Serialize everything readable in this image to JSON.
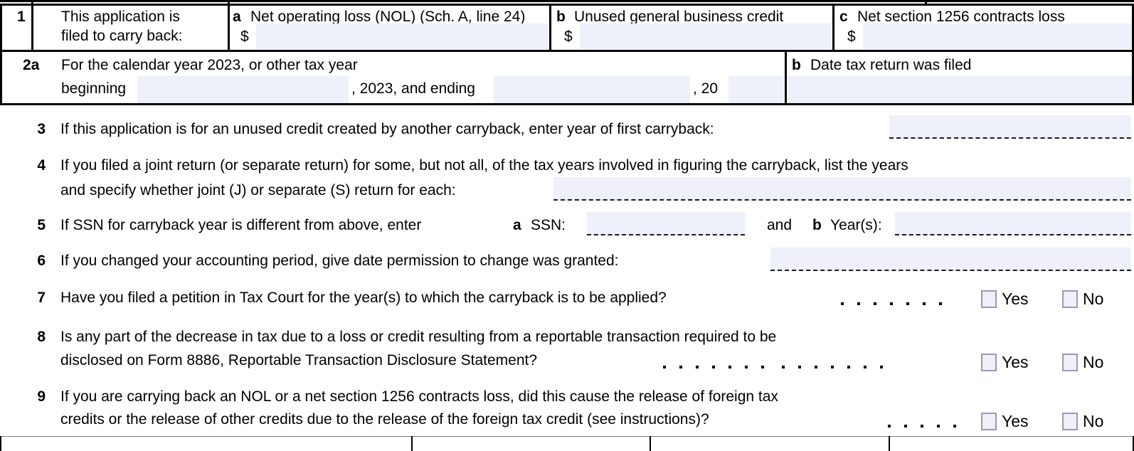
{
  "form": {
    "title": "Form 1045 Application for Tentative Refund",
    "field_fill_color": "#eef0fa",
    "checkbox_border_color": "#9a9aac",
    "rule_color": "#000000"
  },
  "line1": {
    "number": "1",
    "prompt_line_a": "This application is",
    "prompt_line_b": "filed to carry back:",
    "options": [
      {
        "letter": "a",
        "label": "Net operating loss (NOL) (Sch. A, line 24)",
        "currency_symbol": "$",
        "value": ""
      },
      {
        "letter": "b",
        "label": "Unused general business credit",
        "currency_symbol": "$",
        "value": ""
      },
      {
        "letter": "c",
        "label": "Net section 1256 contracts loss",
        "currency_symbol": "$",
        "value": ""
      }
    ]
  },
  "line2": {
    "number": "2a",
    "text_line1": "For the calendar year 2023, or other tax year",
    "beginning_label": "beginning",
    "beginning_value": "",
    "mid_text": ", 2023, and ending",
    "ending_value": "",
    "end_text": ", 20",
    "sub_b": {
      "letter": "b",
      "label": "Date tax return was filed",
      "value": ""
    }
  },
  "line3": {
    "number": "3",
    "text": "If this application is for an unused credit created by another carryback, enter year of first carryback:",
    "value": ""
  },
  "line4": {
    "number": "4",
    "text_line1": "If you filed a joint return (or separate return) for some, but not all, of the tax years involved in figuring the carryback, list the years",
    "text_line2": "and specify whether joint (J) or separate (S) return for each:",
    "value": ""
  },
  "line5": {
    "number": "5",
    "text": "If SSN for carryback year is different from above, enter",
    "sub_a_letter": "a",
    "sub_a_label": "SSN:",
    "sub_a_value": "",
    "conjunction": "and",
    "sub_b_letter": "b",
    "sub_b_label": "Year(s):",
    "sub_b_value": ""
  },
  "line6": {
    "number": "6",
    "text": "If you changed your accounting period, give date permission to change was granted:",
    "value": ""
  },
  "line7": {
    "number": "7",
    "text": "Have you filed a petition in Tax Court for the year(s) to which the carryback is to be applied?",
    "leader_dot_count": 7,
    "yes_label": "Yes",
    "no_label": "No",
    "yes_checked": false,
    "no_checked": false
  },
  "line8": {
    "number": "8",
    "text_line1": "Is any part of the decrease in tax due to a loss or credit resulting from a reportable transaction required to be",
    "text_line2": "disclosed on Form 8886, Reportable Transaction Disclosure Statement?",
    "leader_dot_count": 14,
    "yes_label": "Yes",
    "no_label": "No",
    "yes_checked": false,
    "no_checked": false
  },
  "line9": {
    "number": "9",
    "text_line1": "If you are carrying back an NOL or a net section 1256 contracts loss, did this cause the release of foreign tax",
    "text_line2": "credits or the release of other credits due to the release of the foreign tax credit (see instructions)?",
    "leader_dot_count": 5,
    "yes_label": "Yes",
    "no_label": "No",
    "yes_checked": false,
    "no_checked": false
  }
}
